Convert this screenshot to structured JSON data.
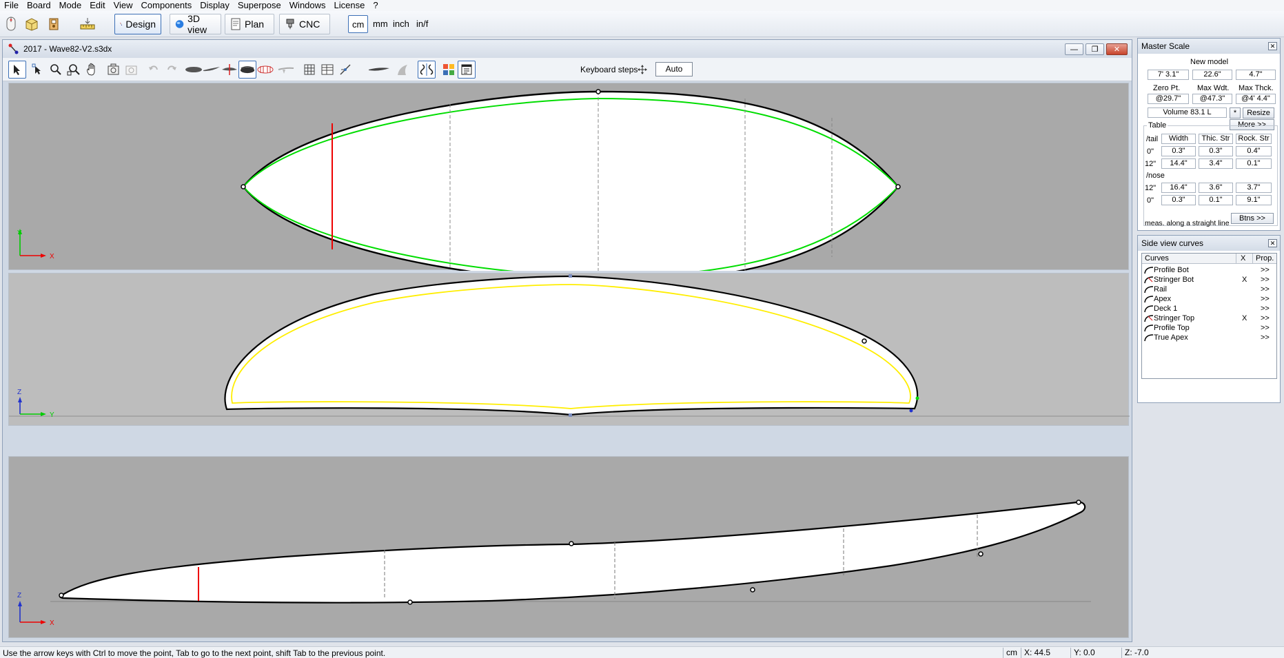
{
  "menu": [
    "File",
    "Board",
    "Mode",
    "Edit",
    "View",
    "Components",
    "Display",
    "Superpose",
    "Windows",
    "License",
    "?"
  ],
  "main_toolbar": {
    "modes": [
      "Design",
      "3D view",
      "Plan",
      "CNC"
    ],
    "units": [
      "cm",
      "mm",
      "inch",
      "in/f"
    ],
    "active_mode": "Design",
    "active_unit": "cm"
  },
  "document": {
    "title": "2017 - Wave82-V2.s3dx",
    "keyboard_steps_label": "Keyboard steps",
    "auto_label": "Auto",
    "axes": {
      "top": [
        "Y",
        "X"
      ],
      "middle": [
        "Z",
        "Y"
      ],
      "bottom": [
        "Z",
        "X"
      ]
    }
  },
  "master_scale": {
    "title": "Master Scale",
    "new_model_label": "New model",
    "length": "7' 3.1\"",
    "width": "22.6\"",
    "thickness": "4.7\"",
    "zero_pt_label": "Zero Pt.",
    "max_wdt_label": "Max Wdt.",
    "max_thck_label": "Max Thck.",
    "zero_pt": "@29.7\"",
    "max_wdt": "@47.3\"",
    "max_thck": "@4' 4.4\"",
    "volume": "Volume  83.1 L",
    "star_label": "*",
    "resize_label": "Resize",
    "more_label": "More >>",
    "table_label": "Table",
    "col_headers": [
      "Width",
      "Thic. Str",
      "Rock. Str"
    ],
    "tail_label": "/tail",
    "nose_label": "/nose",
    "tail_rows": [
      {
        "pos": "0\"",
        "width": "0.3\"",
        "thic": "0.3\"",
        "rock": "0.4\""
      },
      {
        "pos": "12\"",
        "width": "14.4\"",
        "thic": "3.4\"",
        "rock": "0.1\""
      }
    ],
    "nose_rows": [
      {
        "pos": "12\"",
        "width": "16.4\"",
        "thic": "3.6\"",
        "rock": "3.7\""
      },
      {
        "pos": "0\"",
        "width": "0.3\"",
        "thic": "0.1\"",
        "rock": "9.1\""
      }
    ],
    "meas_note": "meas. along a straight line",
    "btns_label": "Btns >>"
  },
  "side_view_curves": {
    "title": "Side view curves",
    "headers": [
      "Curves",
      "X",
      "Prop."
    ],
    "rows": [
      {
        "name": "Profile Bot",
        "x": "",
        "prop": ">>"
      },
      {
        "name": "Stringer Bot",
        "x": "X",
        "prop": ">>"
      },
      {
        "name": "Rail",
        "x": "",
        "prop": ">>"
      },
      {
        "name": "Apex",
        "x": "",
        "prop": ">>"
      },
      {
        "name": "Deck 1",
        "x": "",
        "prop": ">>"
      },
      {
        "name": "Stringer Top",
        "x": "X",
        "prop": ">>"
      },
      {
        "name": "Profile Top",
        "x": "",
        "prop": ">>"
      },
      {
        "name": "True Apex",
        "x": "",
        "prop": ">>"
      }
    ]
  },
  "status": {
    "message": "Use the arrow keys with Ctrl to move the point, Tab to go to the next point, shift Tab to the previous point.",
    "unit": "cm",
    "x": "X: 44.5",
    "y": "Y: 0.0",
    "z": "Z: -7.0"
  },
  "colors": {
    "outline": "#000000",
    "highlight_curve": "#00dd00",
    "deck_curve": "#ffee00",
    "marker": "#ee0000",
    "accent": "#3b6fb6"
  }
}
